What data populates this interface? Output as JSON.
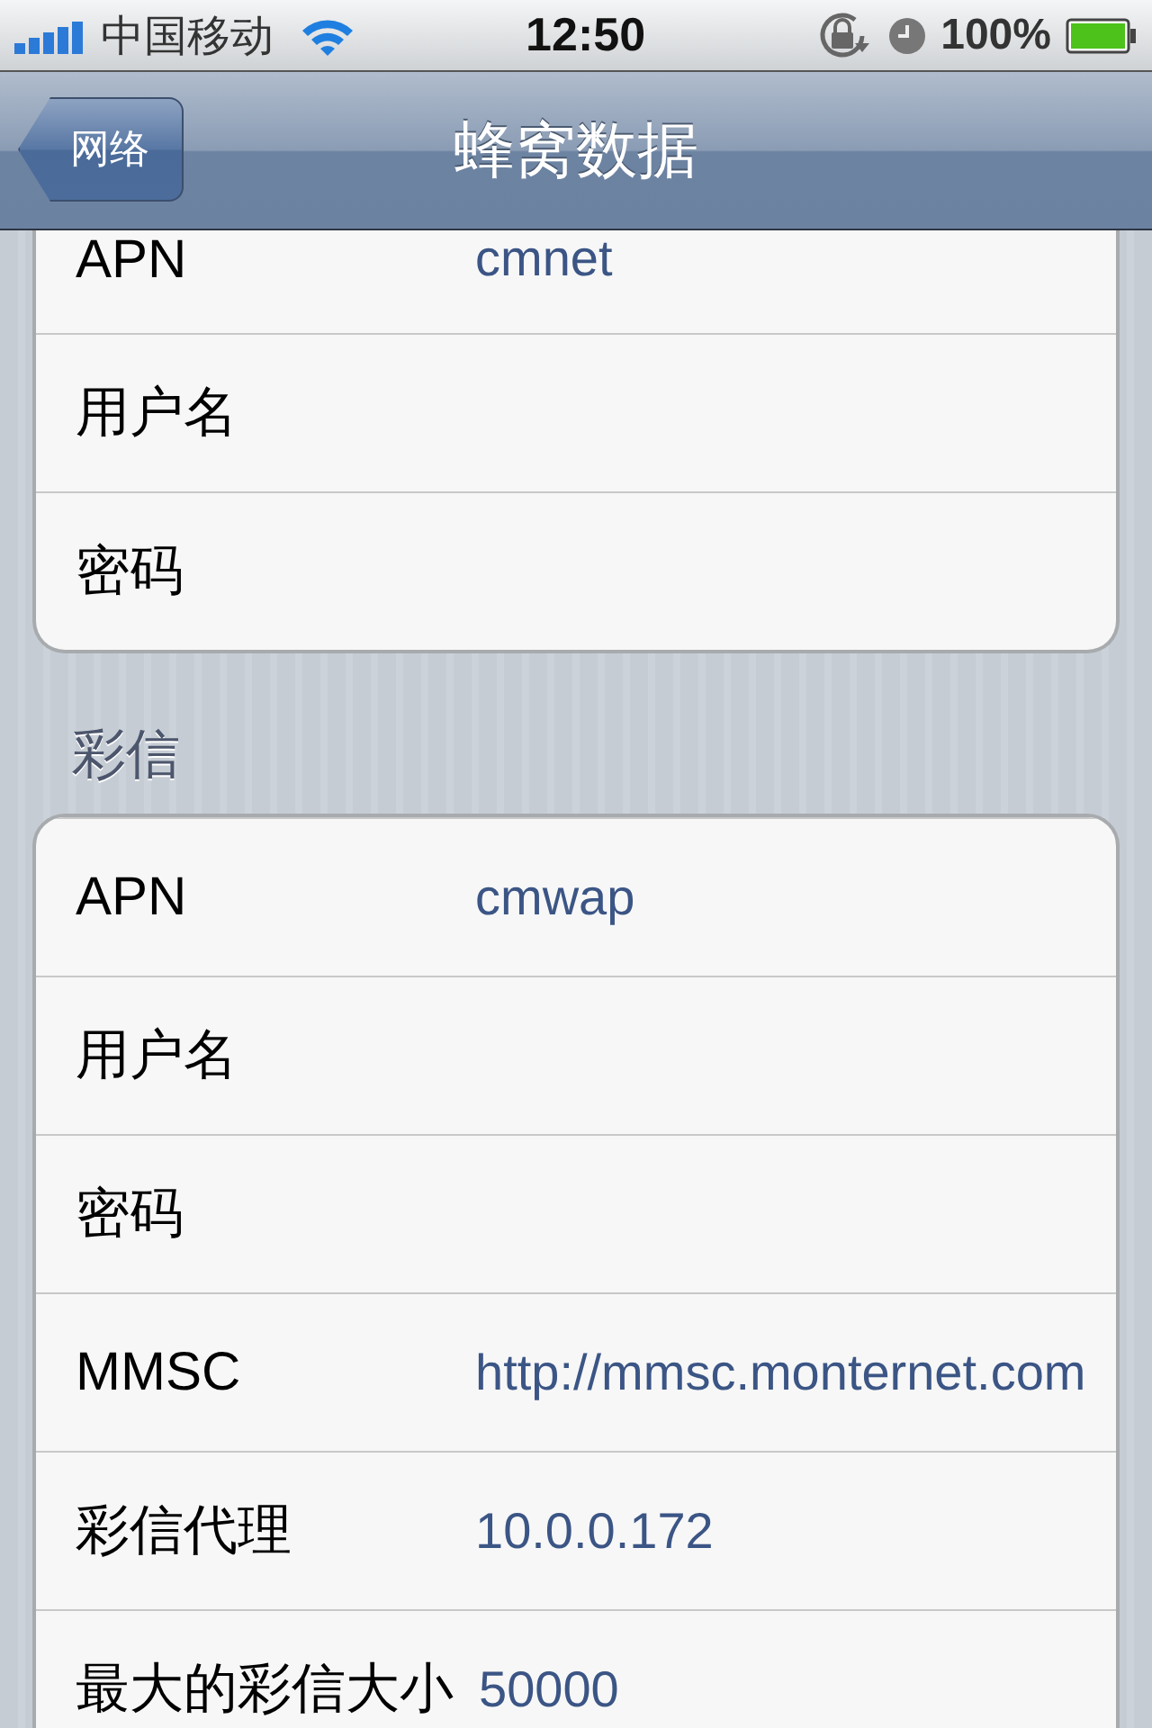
{
  "status_bar": {
    "carrier": "中国移动",
    "time": "12:50",
    "battery": "100%"
  },
  "nav_bar": {
    "back": "网络",
    "title": "蜂窝数据"
  },
  "groups": [
    {
      "rows": [
        {
          "label": "APN",
          "value": "cmnet"
        },
        {
          "label": "用户名"
        },
        {
          "label": "密码"
        }
      ]
    },
    {
      "header": "彩信",
      "rows": [
        {
          "label": "APN",
          "value": "cmwap"
        },
        {
          "label": "用户名"
        },
        {
          "label": "密码"
        },
        {
          "label": "MMSC",
          "value": "http://mmsc.monternet.com"
        },
        {
          "label": "彩信代理",
          "value": "10.0.0.172"
        },
        {
          "label": "最大的彩信大小",
          "value": "50000"
        }
      ]
    }
  ]
}
